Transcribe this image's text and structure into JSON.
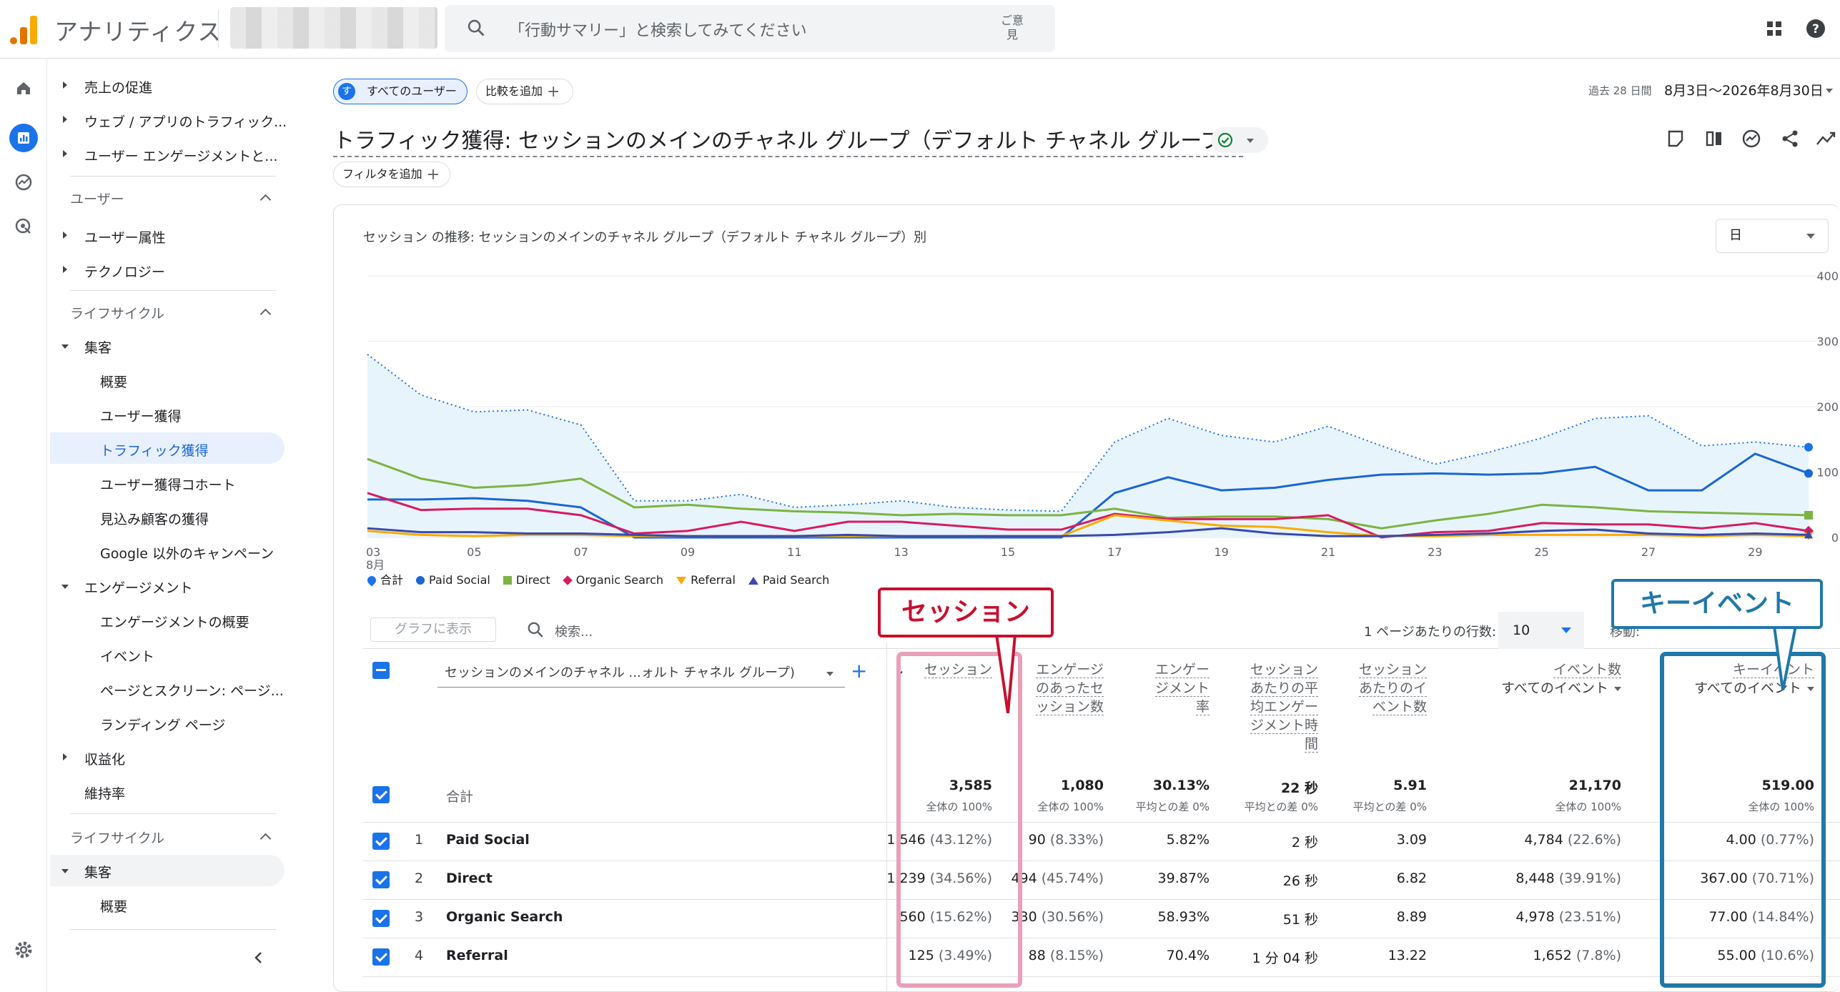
{
  "app": {
    "product_name": "アナリティクス",
    "search_placeholder": "「行動サマリー」と検索してみてください",
    "feedback_label": "ご意見"
  },
  "icons": {
    "logo": "analytics-logo",
    "search": "search-icon",
    "apps": "apps-grid-icon",
    "help": "help-icon",
    "rail": [
      "home-icon",
      "reports-icon",
      "explore-icon",
      "advertising-icon",
      "settings-icon"
    ]
  },
  "sidebar": {
    "items": [
      {
        "label": "売上の促進"
      },
      {
        "label": "ウェブ / アプリのトラフィック..."
      },
      {
        "label": "ユーザー エンゲージメントと..."
      },
      {
        "label": "ユーザー"
      },
      {
        "label": "ユーザー属性"
      },
      {
        "label": "テクノロジー"
      },
      {
        "label": "ライフサイクル"
      },
      {
        "label": "集客"
      },
      {
        "label": "概要"
      },
      {
        "label": "ユーザー獲得"
      },
      {
        "label": "トラフィック獲得"
      },
      {
        "label": "ユーザー獲得コホート"
      },
      {
        "label": "見込み顧客の獲得"
      },
      {
        "label": "Google 以外のキャンペーン"
      },
      {
        "label": "エンゲージメント"
      },
      {
        "label": "エンゲージメントの概要"
      },
      {
        "label": "イベント"
      },
      {
        "label": "ページとスクリーン: ページ..."
      },
      {
        "label": "ランディング ページ"
      },
      {
        "label": "収益化"
      },
      {
        "label": "維持率"
      },
      {
        "label": "ライフサイクル"
      },
      {
        "label": "集客"
      },
      {
        "label": "概要"
      }
    ]
  },
  "filters": {
    "all_users_avatar": "す",
    "all_users": "すべてのユーザー",
    "add_comparison": "比較を追加",
    "add_filter": "フィルタを追加"
  },
  "daterange": {
    "prefix": "過去 28 日間",
    "value": "8月3日～2026年8月30日"
  },
  "page_title": "トラフィック獲得: セッションのメインのチャネル グループ（デフォルト チャネル グループ）",
  "chart": {
    "title": "セッション の推移: セッションのメインのチャネル グループ（デフォルト チャネル グループ）別",
    "granularity": "日",
    "y_ticks": [
      "400",
      "300",
      "200",
      "100",
      "0"
    ],
    "x_ticks": [
      "03",
      "05",
      "07",
      "09",
      "11",
      "13",
      "15",
      "17",
      "19",
      "21",
      "23",
      "25",
      "27",
      "29"
    ],
    "x_month": "8月"
  },
  "chart_data": {
    "type": "line",
    "x": [
      "03",
      "04",
      "05",
      "06",
      "07",
      "08",
      "09",
      "10",
      "11",
      "12",
      "13",
      "14",
      "15",
      "16",
      "17",
      "18",
      "19",
      "20",
      "21",
      "22",
      "23",
      "24",
      "25",
      "26",
      "27",
      "28",
      "29",
      "30"
    ],
    "ylim": [
      0,
      400
    ],
    "grid": true,
    "legend_position": "bottom",
    "series": [
      {
        "name": "合計",
        "color": "#1a73e8",
        "values": [
          280,
          218,
          192,
          195,
          172,
          56,
          56,
          66,
          46,
          50,
          56,
          46,
          42,
          40,
          146,
          182,
          156,
          146,
          170,
          140,
          112,
          130,
          152,
          182,
          186,
          140,
          146,
          138
        ]
      },
      {
        "name": "Paid Social",
        "color": "#1967d2",
        "values": [
          58,
          58,
          60,
          56,
          46,
          0,
          0,
          0,
          0,
          0,
          0,
          0,
          0,
          0,
          68,
          92,
          72,
          76,
          88,
          96,
          98,
          96,
          98,
          108,
          72,
          72,
          128,
          98
        ]
      },
      {
        "name": "Direct",
        "color": "#7cb342",
        "values": [
          120,
          90,
          76,
          80,
          90,
          46,
          50,
          44,
          40,
          38,
          34,
          36,
          34,
          34,
          44,
          30,
          32,
          32,
          28,
          14,
          26,
          36,
          50,
          46,
          40,
          38,
          36,
          34
        ]
      },
      {
        "name": "Organic Search",
        "color": "#d81b60",
        "values": [
          68,
          42,
          44,
          44,
          34,
          6,
          10,
          24,
          10,
          24,
          24,
          18,
          12,
          12,
          36,
          28,
          28,
          28,
          34,
          0,
          8,
          10,
          22,
          20,
          20,
          14,
          22,
          10
        ]
      },
      {
        "name": "Referral",
        "color": "#f9ab00",
        "values": [
          10,
          4,
          2,
          4,
          4,
          2,
          2,
          2,
          2,
          2,
          2,
          2,
          2,
          2,
          34,
          26,
          18,
          16,
          8,
          2,
          2,
          4,
          4,
          4,
          4,
          2,
          4,
          2
        ]
      },
      {
        "name": "Paid Search",
        "color": "#3949ab",
        "values": [
          14,
          8,
          8,
          6,
          6,
          4,
          2,
          2,
          2,
          4,
          2,
          2,
          2,
          2,
          4,
          8,
          14,
          6,
          2,
          2,
          4,
          6,
          10,
          12,
          6,
          4,
          6,
          4
        ]
      }
    ]
  },
  "table_toolbar": {
    "plot_button": "グラフに表示",
    "search_placeholder": "検索...",
    "rows_per_page_label": "1 ページあたりの行数:",
    "rows_per_page": "10",
    "pager_text": "移動:"
  },
  "table": {
    "dimension": "セッションのメインのチャネル ...ォルト チャネル グループ)",
    "columns": [
      {
        "label": "セッション",
        "sub": ""
      },
      {
        "label": "エンゲージのあったセッション数",
        "sub": ""
      },
      {
        "label": "エンゲージメント率",
        "sub": ""
      },
      {
        "label": "セッションあたりの平均エンゲージメント時間",
        "sub": ""
      },
      {
        "label": "セッションあたりのイベント数",
        "sub": ""
      },
      {
        "label": "イベント数",
        "sub": "すべてのイベント"
      },
      {
        "label": "キーイベント",
        "sub": "すべてのイベント"
      }
    ],
    "header_lines": [
      [
        "セッション"
      ],
      [
        "エンゲージ",
        "のあったセ",
        "ッション数"
      ],
      [
        "エンゲー",
        "ジメント",
        "率"
      ],
      [
        "セッション",
        "あたりの平",
        "均エンゲー",
        "ジメント時",
        "間"
      ],
      [
        "セッション",
        "あたりのイ",
        "ベント数"
      ],
      [
        "イベント数"
      ],
      [
        "キーイベント"
      ]
    ],
    "totals_label": "合計",
    "totals": [
      "3,585",
      "1,080",
      "30.13%",
      "22 秒",
      "5.91",
      "21,170",
      "519.00"
    ],
    "totals_sub": [
      "全体の 100%",
      "全体の 100%",
      "平均との差 0%",
      "平均との差 0%",
      "平均との差 0%",
      "全体の 100%",
      "全体の 100%"
    ],
    "rows": [
      {
        "num": "1",
        "name": "Paid Social",
        "cells": [
          [
            "1,546",
            "(43.12%)"
          ],
          [
            "90",
            "(8.33%)"
          ],
          [
            "5.82%",
            ""
          ],
          [
            "2 秒",
            ""
          ],
          [
            "3.09",
            ""
          ],
          [
            "4,784",
            "(22.6%)"
          ],
          [
            "4.00",
            "(0.77%)"
          ]
        ]
      },
      {
        "num": "2",
        "name": "Direct",
        "cells": [
          [
            "1,239",
            "(34.56%)"
          ],
          [
            "494",
            "(45.74%)"
          ],
          [
            "39.87%",
            ""
          ],
          [
            "26 秒",
            ""
          ],
          [
            "6.82",
            ""
          ],
          [
            "8,448",
            "(39.91%)"
          ],
          [
            "367.00",
            "(70.71%)"
          ]
        ]
      },
      {
        "num": "3",
        "name": "Organic Search",
        "cells": [
          [
            "560",
            "(15.62%)"
          ],
          [
            "330",
            "(30.56%)"
          ],
          [
            "58.93%",
            ""
          ],
          [
            "51 秒",
            ""
          ],
          [
            "8.89",
            ""
          ],
          [
            "4,978",
            "(23.51%)"
          ],
          [
            "77.00",
            "(14.84%)"
          ]
        ]
      },
      {
        "num": "4",
        "name": "Referral",
        "cells": [
          [
            "125",
            "(3.49%)"
          ],
          [
            "88",
            "(8.15%)"
          ],
          [
            "70.4%",
            ""
          ],
          [
            "1 分 04 秒",
            ""
          ],
          [
            "13.22",
            ""
          ],
          [
            "1,652",
            "(7.8%)"
          ],
          [
            "55.00",
            "(10.6%)"
          ]
        ]
      }
    ]
  },
  "callouts": {
    "session": "セッション",
    "key_event": "キーイベント"
  },
  "colors": {
    "accent": "#1a73e8",
    "callout_session": "#c8102e",
    "callout_key": "#1f78a8",
    "logo_orange": "#f9ab00",
    "logo_dark": "#e37400"
  }
}
